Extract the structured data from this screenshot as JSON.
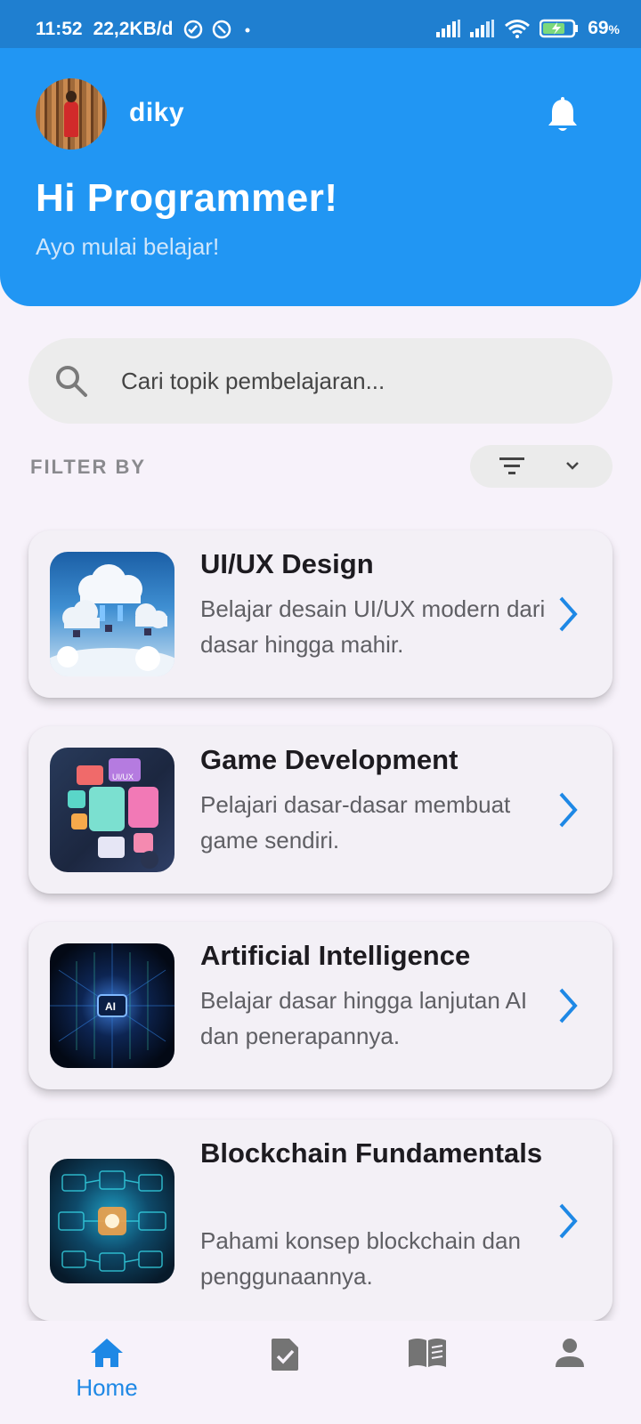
{
  "status_bar": {
    "time": "11:52",
    "network_speed": "22,2KB/d",
    "battery": "69",
    "battery_unit": "%"
  },
  "header": {
    "username": "diky",
    "greeting": "Hi Programmer!",
    "subtitle": "Ayo mulai belajar!"
  },
  "search": {
    "placeholder": "Cari topik pembelajaran..."
  },
  "filter": {
    "label": "FILTER BY"
  },
  "topics": [
    {
      "title": "UI/UX Design",
      "description": "Belajar desain UI/UX modern dari dasar hingga mahir."
    },
    {
      "title": "Game Development",
      "description": "Pelajari dasar-dasar membuat game sendiri."
    },
    {
      "title": "Artificial Intelligence",
      "description": "Belajar dasar hingga lanjutan AI dan penerapannya."
    },
    {
      "title": "Blockchain Fundamentals",
      "description": "Pahami konsep blockchain dan penggunaannya."
    }
  ],
  "thumbnail_labels": {
    "game": "UI/UX",
    "ai": "AI"
  },
  "bottom_nav": {
    "home_label": "Home",
    "items": [
      "home-icon",
      "task-icon",
      "book-icon",
      "profile-icon"
    ]
  },
  "colors": {
    "primary": "#2196f3",
    "status_bar": "#1f7fd0",
    "background": "#f7f2fa",
    "card": "#f3f0f6"
  }
}
